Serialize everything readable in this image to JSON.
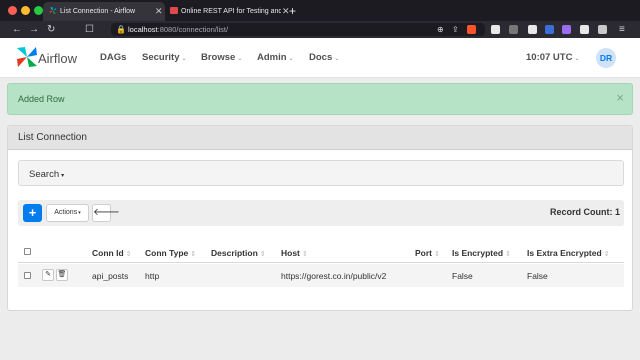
{
  "browser": {
    "tabs": [
      {
        "label": "List Connection - Airflow",
        "active": true
      },
      {
        "label": "Online REST API for Testing and Pr",
        "active": false
      }
    ],
    "new_tab_glyph": "+",
    "url_host": "localhost",
    "url_path": ":8080/connection/list/"
  },
  "navbar": {
    "brand": "Airflow",
    "items": [
      {
        "label": "DAGs",
        "dropdown": false
      },
      {
        "label": "Security",
        "dropdown": true
      },
      {
        "label": "Browse",
        "dropdown": true
      },
      {
        "label": "Admin",
        "dropdown": true
      },
      {
        "label": "Docs",
        "dropdown": true
      }
    ],
    "clock": "10:07 UTC",
    "avatar": "DR"
  },
  "flash": {
    "message": "Added Row",
    "close": "×",
    "color": "#b6e3c6"
  },
  "panel": {
    "title": "List Connection",
    "search_label": "Search",
    "actions_label": "Actions",
    "record_count": "Record Count: 1"
  },
  "table": {
    "columns": [
      "Conn Id",
      "Conn Type",
      "Description",
      "Host",
      "Port",
      "Is Encrypted",
      "Is Extra Encrypted"
    ],
    "rows": [
      {
        "conn_id": "api_posts",
        "conn_type": "http",
        "description": "",
        "host": "https://gorest.co.in/public/v2",
        "port": "",
        "is_encrypted": "False",
        "is_extra_encrypted": "False"
      }
    ]
  },
  "colors": {
    "accent": "#017cee",
    "brand_text": "#51504f"
  }
}
